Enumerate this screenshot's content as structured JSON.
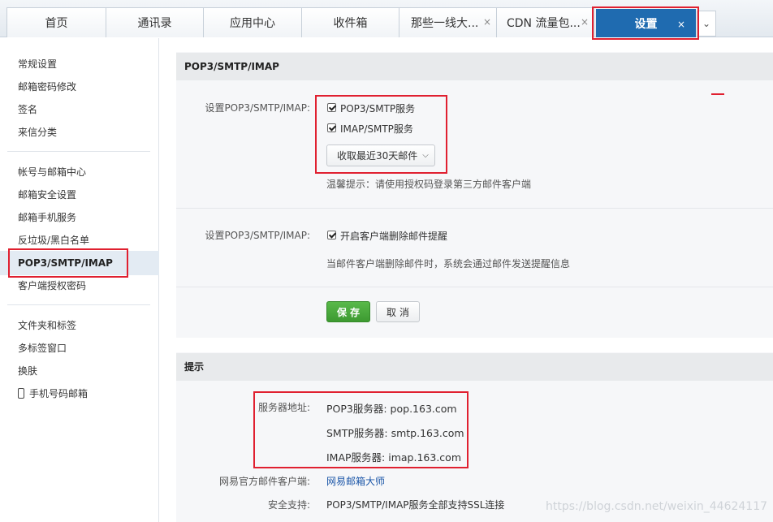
{
  "tabs": [
    {
      "label": "首页",
      "closable": false,
      "active": false
    },
    {
      "label": "通讯录",
      "closable": false,
      "active": false
    },
    {
      "label": "应用中心",
      "closable": false,
      "active": false
    },
    {
      "label": "收件箱",
      "closable": false,
      "active": false
    },
    {
      "label": "那些一线大...",
      "closable": true,
      "active": false
    },
    {
      "label": "CDN 流量包...",
      "closable": true,
      "active": false
    },
    {
      "label": "设置",
      "closable": true,
      "active": true
    }
  ],
  "tab_close_glyph": "×",
  "tab_more_glyph": "⌄",
  "sidebar": {
    "groups": [
      [
        "常规设置",
        "邮箱密码修改",
        "签名",
        "来信分类"
      ],
      [
        "帐号与邮箱中心",
        "邮箱安全设置",
        "邮箱手机服务",
        "反垃圾/黑白名单",
        "POP3/SMTP/IMAP",
        "客户端授权密码"
      ],
      [
        "文件夹和标签",
        "多标签窗口",
        "换肤",
        "手机号码邮箱"
      ]
    ],
    "active_item": "POP3/SMTP/IMAP"
  },
  "section1": {
    "title": "POP3/SMTP/IMAP",
    "row1_label": "设置POP3/SMTP/IMAP:",
    "options": [
      {
        "label": "POP3/SMTP服务",
        "checked": true
      },
      {
        "label": "IMAP/SMTP服务",
        "checked": true
      }
    ],
    "dropdown_value": "收取最近30天邮件",
    "dropdown_chevron": "⌵",
    "tip": "温馨提示：请使用授权码登录第三方邮件客户端",
    "row2_label": "设置POP3/SMTP/IMAP:",
    "delete_notify": {
      "label": "开启客户端删除邮件提醒",
      "checked": true
    },
    "delete_notify_desc": "当邮件客户端删除邮件时，系统会通过邮件发送提醒信息",
    "save_label": "保存",
    "cancel_label": "取消"
  },
  "section2": {
    "title": "提示",
    "server_label": "服务器地址:",
    "servers": [
      "POP3服务器: pop.163.com",
      "SMTP服务器: smtp.163.com",
      "IMAP服务器: imap.163.com"
    ],
    "client_label": "网易官方邮件客户端:",
    "client_link": "网易邮箱大师",
    "security_label": "安全支持:",
    "security_text": "POP3/SMTP/IMAP服务全部支持SSL连接"
  },
  "watermark": "https://blog.csdn.net/weixin_44624117",
  "colors": {
    "accent": "#1f6bb0",
    "highlight": "#e02030",
    "save": "#4aa83c",
    "link": "#1b56a8"
  }
}
